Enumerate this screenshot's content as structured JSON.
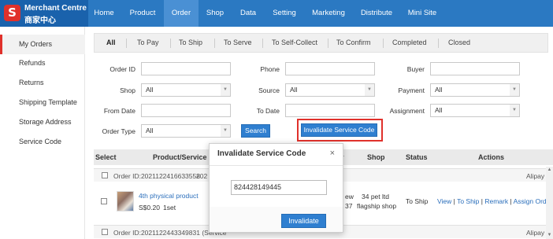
{
  "brand": {
    "logo_letter": "S",
    "title_en": "Merchant Centre",
    "title_zh": "商家中心"
  },
  "nav": {
    "items": [
      "Home",
      "Product",
      "Order",
      "Shop",
      "Data",
      "Setting",
      "Marketing",
      "Distribute",
      "Mini Site"
    ],
    "active": "Order"
  },
  "sidebar": {
    "items": [
      "My Orders",
      "Refunds",
      "Returns",
      "Shipping Template",
      "Storage Address",
      "Service Code"
    ],
    "active": "My Orders"
  },
  "tabs": {
    "items": [
      "All",
      "To Pay",
      "To Ship",
      "To Serve",
      "To Self-Collect",
      "To Confirm",
      "Completed",
      "Closed"
    ],
    "active": "All"
  },
  "filters": {
    "order_id_label": "Order ID",
    "phone_label": "Phone",
    "buyer_label": "Buyer",
    "shop_label": "Shop",
    "shop_value": "All",
    "source_label": "Source",
    "source_value": "All",
    "payment_label": "Payment",
    "payment_value": "All",
    "from_date_label": "From Date",
    "to_date_label": "To Date",
    "assignment_label": "Assignment",
    "assignment_value": "All",
    "order_type_label": "Order Type",
    "order_type_value": "All",
    "search_label": "Search",
    "invalidate_label": "Invalidate Service Code"
  },
  "table": {
    "headers": [
      "Select",
      "Product/Service",
      "Shop",
      "Status",
      "Actions"
    ],
    "header_partial": "r",
    "orders": [
      {
        "header": "Order ID:2021122416633558",
        "header_extra": "202",
        "payment": "Alipay",
        "product_name": "4th physical product",
        "price": "S$0.20",
        "qty": "1set",
        "partial_1": "ew",
        "partial_2": "37",
        "shop_line1": "34 pet ltd",
        "shop_line2": "flagship shop",
        "status": "To Ship",
        "actions": [
          "View",
          "To Ship",
          "Remark",
          "Assign Order"
        ]
      },
      {
        "header": "Order ID:2021122443349831 (Service",
        "payment": "Alipay"
      }
    ]
  },
  "modal": {
    "title": "Invalidate Service Code",
    "close": "×",
    "input_value": "824428149445",
    "button": "Invalidate"
  }
}
